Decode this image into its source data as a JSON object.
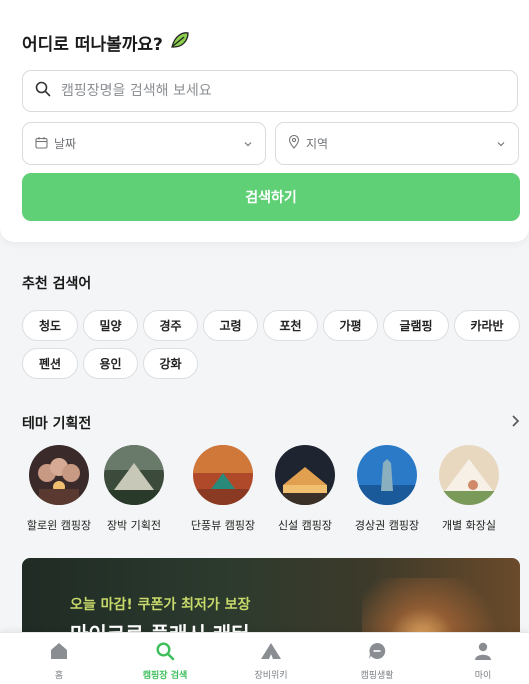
{
  "header": {
    "title": "어디로 떠나볼까요?"
  },
  "search": {
    "placeholder": "캠핑장명을 검색해 보세요"
  },
  "filters": {
    "date_label": "날짜",
    "region_label": "지역"
  },
  "search_button": {
    "label": "검색하기"
  },
  "recommended": {
    "title": "추천 검색어",
    "keywords": [
      "청도",
      "밀양",
      "경주",
      "고령",
      "포천",
      "가평",
      "글램핑",
      "카라반",
      "펜션",
      "용인",
      "강화"
    ]
  },
  "themes": {
    "title": "테마 기획전",
    "items": [
      "할로윈 캠핑장",
      "장박 기획전",
      "단풍뷰 캠핑장",
      "신설 캠핑장",
      "경상권 캠핑장",
      "개별 화장실"
    ]
  },
  "banner": {
    "subtitle": "오늘 마감! 쿠폰가 최저가 보장",
    "title": "마이크로 플래시 래터"
  },
  "bottom_nav": {
    "items": [
      {
        "label": "홈",
        "icon": "home-icon"
      },
      {
        "label": "캠핑장 검색",
        "icon": "search-icon"
      },
      {
        "label": "장비위키",
        "icon": "tent-icon"
      },
      {
        "label": "캠핑생활",
        "icon": "chat-icon"
      },
      {
        "label": "마이",
        "icon": "user-icon"
      }
    ],
    "active_index": 1
  },
  "colors": {
    "accent": "#5fd076",
    "active_nav": "#3fbf5c",
    "banner_subtitle": "#c7d96a"
  }
}
